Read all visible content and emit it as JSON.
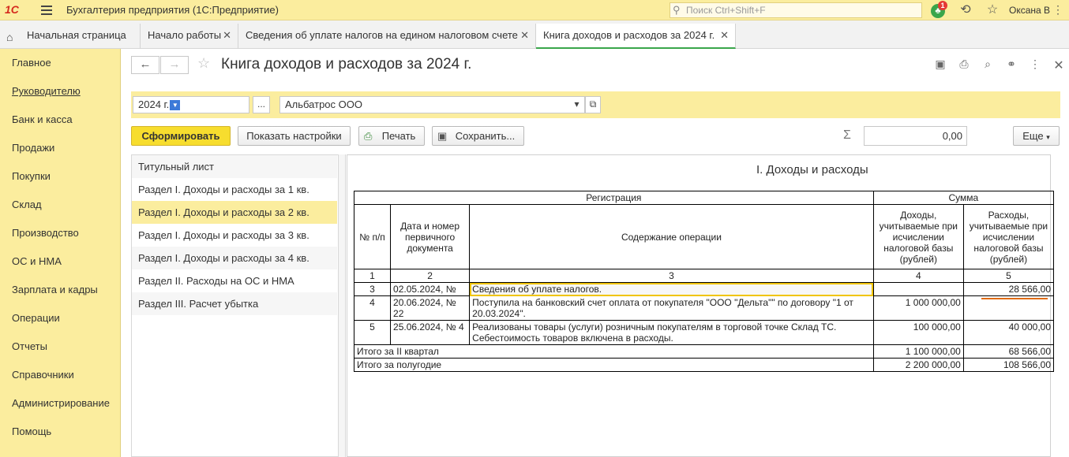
{
  "topbar": {
    "logo": "1С",
    "app_title": "Бухгалтерия предприятия  (1С:Предприятие)",
    "search_placeholder": "Поиск Ctrl+Shift+F",
    "notifications_count": "1",
    "user": "Оксана В"
  },
  "tabs": [
    {
      "label": "Начальная страница"
    },
    {
      "label": "Начало работы"
    },
    {
      "label": "Сведения об уплате налогов на едином налоговом счете"
    },
    {
      "label": "Книга доходов и расходов за 2024 г."
    }
  ],
  "sidebar": {
    "items": [
      {
        "label": "Главное"
      },
      {
        "label": "Руководителю"
      },
      {
        "label": "Банк и касса"
      },
      {
        "label": "Продажи"
      },
      {
        "label": "Покупки"
      },
      {
        "label": "Склад"
      },
      {
        "label": "Производство"
      },
      {
        "label": "ОС и НМА"
      },
      {
        "label": "Зарплата и кадры"
      },
      {
        "label": "Операции"
      },
      {
        "label": "Отчеты"
      },
      {
        "label": "Справочники"
      },
      {
        "label": "Администрирование"
      },
      {
        "label": "Помощь"
      }
    ]
  },
  "page": {
    "title": "Книга доходов и расходов за 2024 г.",
    "period": "2024 г.",
    "organization": "Альбатрос ООО",
    "ellipsis": "...",
    "buttons": {
      "generate": "Сформировать",
      "show_settings": "Показать настройки",
      "print": "Печать",
      "save": "Сохранить...",
      "more": "Еще"
    },
    "sum_value": "0,00"
  },
  "sections": [
    {
      "label": "Титульный лист"
    },
    {
      "label": "Раздел I. Доходы и расходы за 1 кв."
    },
    {
      "label": "Раздел I. Доходы и расходы за 2 кв."
    },
    {
      "label": "Раздел I. Доходы и расходы за 3 кв."
    },
    {
      "label": "Раздел I. Доходы и расходы за 4 кв."
    },
    {
      "label": "Раздел II. Расходы на ОС и НМА"
    },
    {
      "label": "Раздел III. Расчет убытка"
    }
  ],
  "report": {
    "title": "I. Доходы и расходы",
    "header": {
      "registration": "Регистрация",
      "sum": "Сумма",
      "num": "№ п/п",
      "doc": "Дата и номер первичного документа",
      "content": "Содержание операции",
      "income": "Доходы, учитываемые при исчислении налоговой базы (рублей)",
      "expense": "Расходы, учитываемые при исчислении налоговой базы (рублей)",
      "col_nums": [
        "1",
        "2",
        "3",
        "4",
        "5"
      ]
    },
    "rows": [
      {
        "num": "3",
        "doc": "02.05.2024, №",
        "content": "Сведения об уплате налогов.",
        "income": "",
        "expense": "28 566,00"
      },
      {
        "num": "4",
        "doc": "20.06.2024, № 22",
        "content": "Поступила на банковский счет оплата от покупателя \"ООО \"Дельта\"\" по договору \"1 от 20.03.2024\".",
        "income": "1 000 000,00",
        "expense": ""
      },
      {
        "num": "5",
        "doc": "25.06.2024, № 4",
        "content": "Реализованы товары (услуги) розничным покупателям в торговой точке Склад ТС. Себестоимость товаров включена в расходы.",
        "income": "100 000,00",
        "expense": "40 000,00"
      }
    ],
    "totals": [
      {
        "label": "Итого за II квартал",
        "income": "1 100 000,00",
        "expense": "68 566,00"
      },
      {
        "label": "Итого за полугодие",
        "income": "2 200 000,00",
        "expense": "108 566,00"
      }
    ]
  }
}
